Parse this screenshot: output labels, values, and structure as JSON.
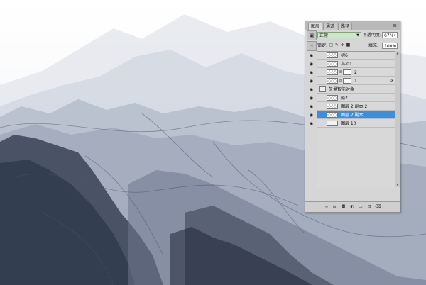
{
  "panel": {
    "tabs": [
      {
        "label": "图层",
        "active": true
      },
      {
        "label": "通道",
        "active": false
      },
      {
        "label": "路径",
        "active": false
      }
    ],
    "blend_mode": "正常",
    "opacity_label": "不透明度:",
    "opacity_value": "67%",
    "lock_label": "锁定:",
    "fill_label": "填充:",
    "fill_value": "100%",
    "layers": [
      {
        "name": "树6",
        "selected": false,
        "mask": false
      },
      {
        "name": "鸟-01",
        "selected": false,
        "mask": false
      },
      {
        "name": "2",
        "selected": false,
        "mask": true
      },
      {
        "name": "1",
        "selected": false,
        "mask": true,
        "fx": "fx"
      },
      {
        "name": "矢量智能对象",
        "selected": false,
        "mask": false,
        "smart": true
      },
      {
        "name": "船2",
        "selected": false,
        "mask": false
      },
      {
        "name": "图层 2 副本 2",
        "selected": false,
        "mask": false
      },
      {
        "name": "图层 2 副本",
        "selected": true,
        "mask": false
      },
      {
        "name": "图层 10",
        "selected": false,
        "mask": false
      }
    ],
    "footer_fx": "fx."
  },
  "colors": {
    "ink_dark": "#2b3447",
    "ink_mid": "#6b7690",
    "ink_light": "#b7bfcf",
    "paper": "#f4f5f8",
    "selection": "#3a8fe0",
    "blend_field": "#c8eac0"
  }
}
